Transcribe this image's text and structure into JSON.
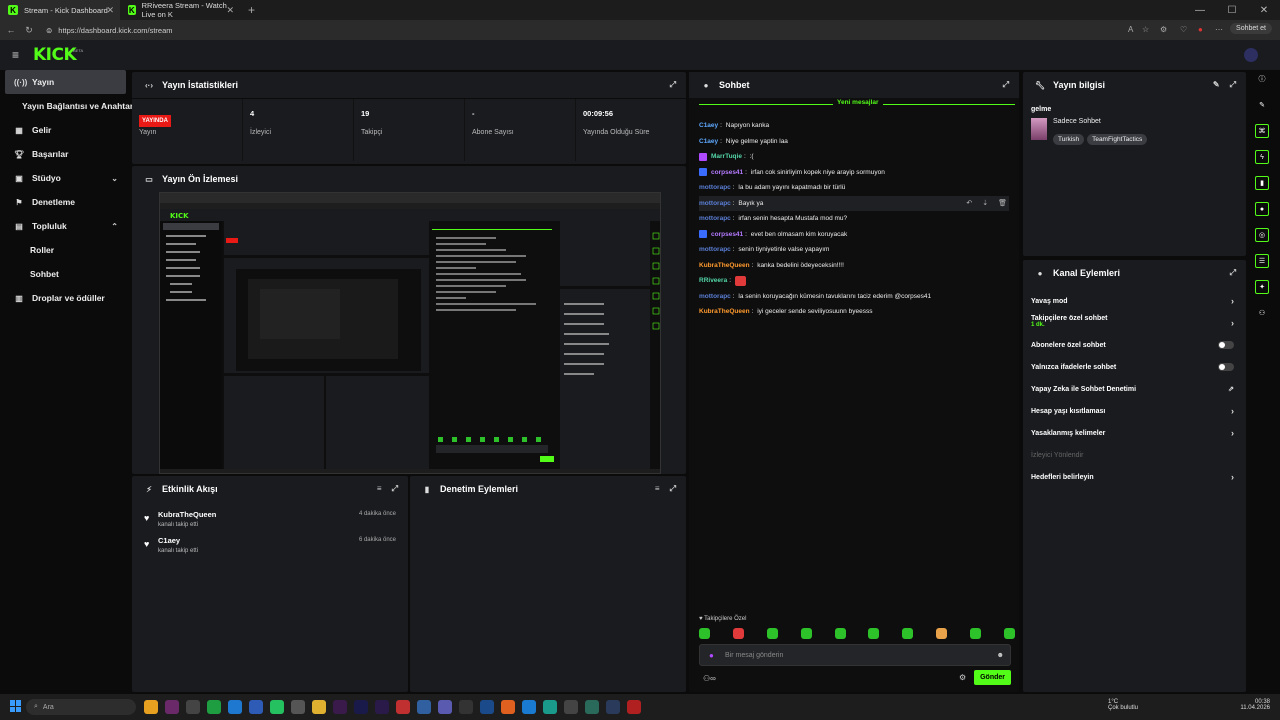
{
  "browser": {
    "tabs": [
      {
        "label": "Stream - Kick Dashboard",
        "active": true
      },
      {
        "label": "RRiveera Stream - Watch Live on K",
        "active": false
      }
    ],
    "url": "https://dashboard.kick.com/stream",
    "profile_button": "Sohbet et"
  },
  "header": {
    "logo": "KICK",
    "beta": "BETA"
  },
  "sidebar": {
    "items": [
      {
        "label": "Yayın",
        "icon": "stream-icon",
        "active": true
      },
      {
        "label": "Yayın Bağlantısı ve Anahtarı",
        "sub": true
      },
      {
        "label": "Gelir",
        "icon": "revenue-icon"
      },
      {
        "label": "Başarılar",
        "icon": "trophy-icon"
      },
      {
        "label": "Stüdyo",
        "icon": "studio-icon",
        "chevron": "down"
      },
      {
        "label": "Denetleme",
        "icon": "moderation-icon"
      },
      {
        "label": "Topluluk",
        "icon": "community-icon",
        "chevron": "up"
      },
      {
        "label": "Roller",
        "sub": true
      },
      {
        "label": "Sohbet",
        "sub": true
      },
      {
        "label": "Droplar ve ödüller",
        "icon": "drops-icon"
      }
    ]
  },
  "stats": {
    "title": "Yayın İstatistikleri",
    "live_badge": "YAYINDA",
    "cells": [
      {
        "value": "",
        "label": "Yayın"
      },
      {
        "value": "4",
        "label": "İzleyici"
      },
      {
        "value": "19",
        "label": "Takipçi"
      },
      {
        "value": "-",
        "label": "Abone Sayısı"
      },
      {
        "value": "00:09:56",
        "label": "Yayında Olduğu Süre"
      }
    ]
  },
  "preview": {
    "title": "Yayın Ön İzlemesi"
  },
  "activity": {
    "title": "Etkinlik Akışı",
    "items": [
      {
        "name": "KubraTheQueen",
        "desc": "kanalı takip etti",
        "time": "4 dakika önce"
      },
      {
        "name": "C1aey",
        "desc": "kanalı takip etti",
        "time": "6 dakika önce"
      }
    ]
  },
  "moderation": {
    "title": "Denetim Eylemleri"
  },
  "chat": {
    "title": "Sohbet",
    "new_messages": "Yeni mesajlar",
    "messages": [
      {
        "user": "C1aey",
        "text": "Napıyon kanka",
        "color": "#5ea9ff",
        "badge": ""
      },
      {
        "user": "C1aey",
        "text": "Niye gelme yaptin laa",
        "color": "#5ea9ff",
        "badge": ""
      },
      {
        "user": "MarrTuqie",
        "text": ":(",
        "color": "#53d6a8",
        "badge": "#b04aff"
      },
      {
        "user": "corpses41",
        "text": "irfan cok sinirliyim kopek niye arayip sormuyon",
        "color": "#b57bff",
        "badge": "#3a6cff"
      },
      {
        "user": "mottorapc",
        "text": "la bu adam yayını kapatmadı bir türlü",
        "color": "#5b7fd6",
        "badge": ""
      },
      {
        "user": "mottorapc",
        "text": "Bayık ya",
        "color": "#5b7fd6",
        "badge": ""
      },
      {
        "user": "mottorapc",
        "text": "irfan senin hesapta Mustafa mod mu?",
        "color": "#5b7fd6",
        "badge": ""
      },
      {
        "user": "corpses41",
        "text": "evet ben olmasam kim koruyacak",
        "color": "#b57bff",
        "badge": "#3a6cff"
      },
      {
        "user": "mottorapc",
        "text": "senin tiyniyetinle valse yapayım",
        "color": "#5b7fd6",
        "badge": ""
      },
      {
        "user": "KubraTheQueen",
        "text": "kanka bedelini ödeyeceksin!!!!",
        "color": "#ff9a2e",
        "badge": ""
      },
      {
        "user": "RRiveera",
        "text": "",
        "color": "#53d6a8",
        "badge": "",
        "emote": true
      },
      {
        "user": "mottorapc",
        "text": "la senin koruyacağın kümesin tavuklarını taciz ederim @corpses41",
        "color": "#5b7fd6",
        "badge": ""
      },
      {
        "user": "KubraTheQueen",
        "text": "iyi geceler sende seviliyosuunn byeesss",
        "color": "#ff9a2e",
        "badge": ""
      }
    ],
    "followers_only": "Takipçilere Özel",
    "placeholder": "Bir mesaj gönderin",
    "send": "Gönder"
  },
  "stream_info": {
    "title": "Yayın bilgisi",
    "stream_title": "gelme",
    "category": "Sadece Sohbet",
    "tags": [
      "Turkish",
      "TeamFightTactics"
    ]
  },
  "channel_actions": {
    "title": "Kanal Eylemleri",
    "items": [
      {
        "label": "Yavaş mod",
        "type": "arrow"
      },
      {
        "label": "Takipçilere özel sohbet",
        "sub": "1 dk.",
        "type": "arrow"
      },
      {
        "label": "Abonelere özel sohbet",
        "type": "toggle"
      },
      {
        "label": "Yalnızca ifadelerle sohbet",
        "type": "toggle"
      },
      {
        "label": "Yapay Zeka ile Sohbet Denetimi",
        "type": "external"
      },
      {
        "label": "Hesap yaşı kısıtlaması",
        "type": "arrow"
      },
      {
        "label": "Yasaklanmış kelimeler",
        "type": "arrow"
      },
      {
        "label": "İzleyici Yönlendir",
        "type": "disabled"
      },
      {
        "label": "Hedefleri belirleyin",
        "type": "arrow"
      }
    ]
  },
  "taskbar": {
    "search": "Ara",
    "weather_temp": "1°C",
    "weather_desc": "Çok bulutlu",
    "time": "00:38",
    "date": "11.04.2026"
  }
}
